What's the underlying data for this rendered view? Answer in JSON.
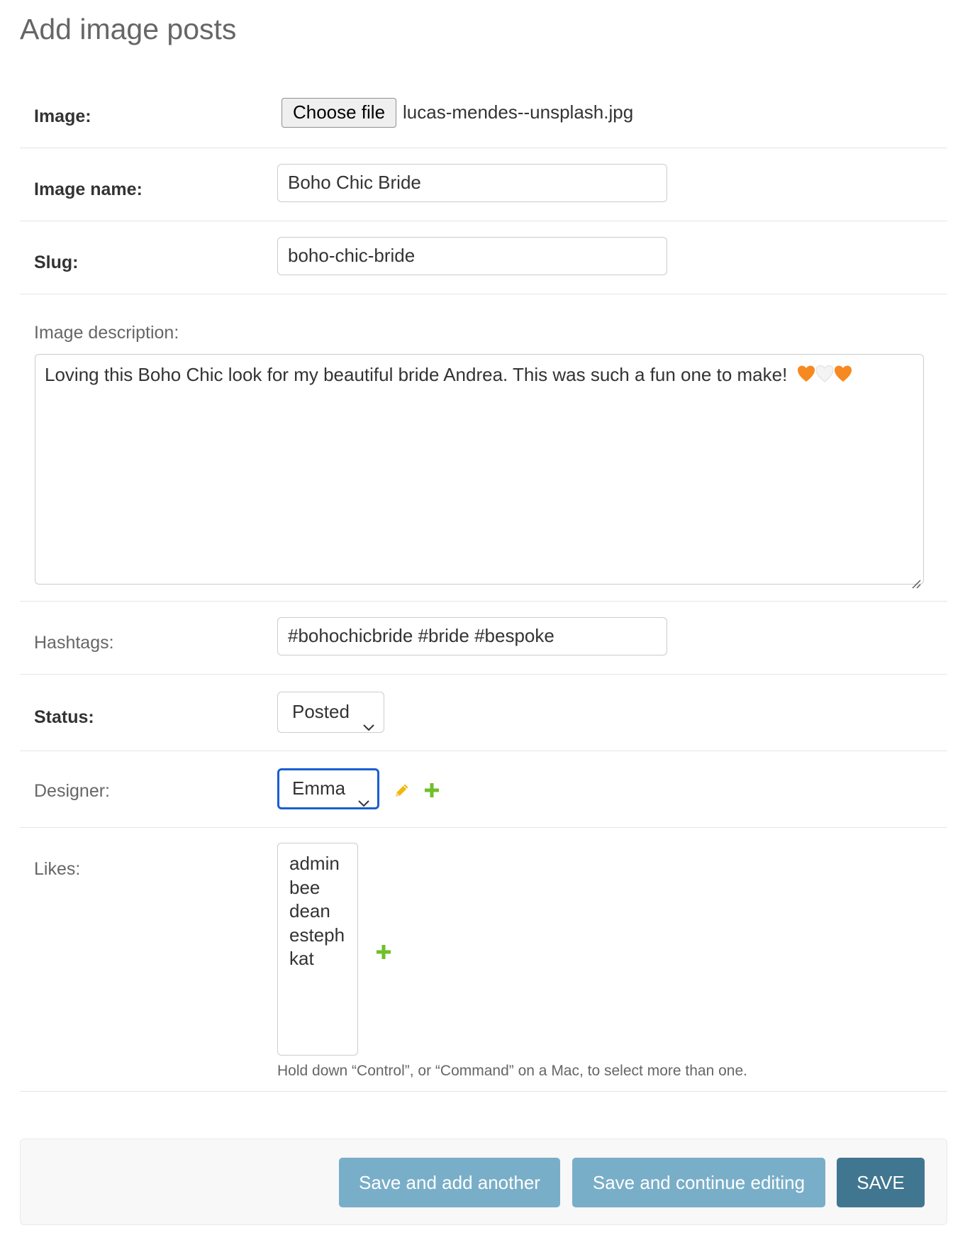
{
  "page": {
    "title": "Add image posts"
  },
  "fields": {
    "image": {
      "label": "Image:",
      "button_label": "Choose file",
      "file_name": "lucas-mendes--unsplash.jpg"
    },
    "image_name": {
      "label": "Image name:",
      "value": "Boho Chic Bride"
    },
    "slug": {
      "label": "Slug:",
      "value": "boho-chic-bride"
    },
    "image_description": {
      "label": "Image description:",
      "value": "Loving this Boho Chic look for my beautiful bride Andrea. This was such a fun one to make!",
      "emoji": "🧡🤍🧡"
    },
    "hashtags": {
      "label": "Hashtags:",
      "value": "#bohochicbride #bride #bespoke"
    },
    "status": {
      "label": "Status:",
      "selected": "Posted"
    },
    "designer": {
      "label": "Designer:",
      "selected": "Emma",
      "icons": [
        "pencil-icon",
        "plus-icon"
      ]
    },
    "likes": {
      "label": "Likes:",
      "options": [
        "admin",
        "bee",
        "dean",
        "esteph",
        "kat"
      ],
      "help_text": "Hold down “Control”, or “Command” on a Mac, to select more than one.",
      "icons": [
        "plus-icon"
      ]
    }
  },
  "actions": {
    "save_add_another": "Save and add another",
    "save_continue": "Save and continue editing",
    "save": "SAVE"
  },
  "colors": {
    "primary_button": "#417690",
    "secondary_button": "#79aec8",
    "add_icon": "#70bf2b",
    "edit_icon": "#efb80b",
    "focus_ring": "#1a5fd0"
  }
}
